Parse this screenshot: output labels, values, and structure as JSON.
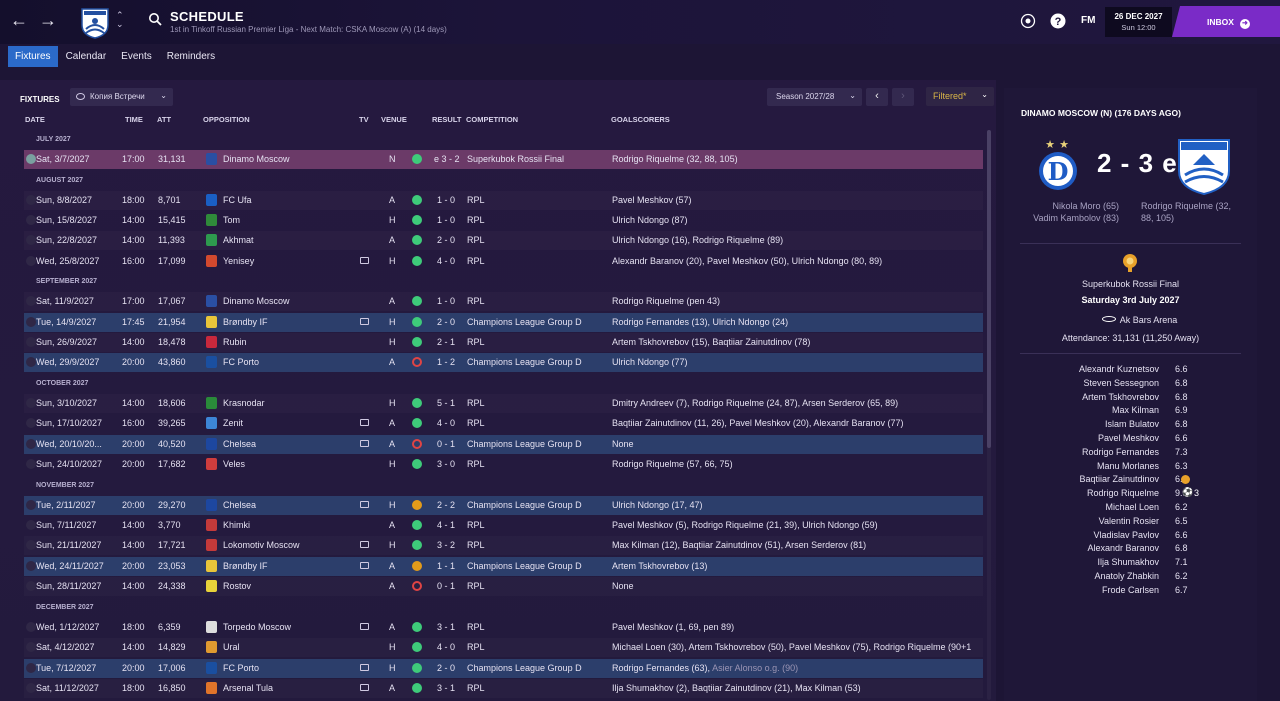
{
  "header": {
    "title": "SCHEDULE",
    "subtitle": "1st in Tinkoff Russian Premier Liga - Next Match: CSKA Moscow (A) (14 days)",
    "fm": "FM",
    "date": "26 DEC 2027",
    "time": "Sun 12:00",
    "inbox": "INBOX"
  },
  "tabs": [
    "Fixtures",
    "Calendar",
    "Events",
    "Reminders"
  ],
  "toolbar": {
    "fixtures_label": "FIXTURES",
    "view": "Копия Встречи",
    "season": "Season 2027/28",
    "filter": "Filtered*"
  },
  "columns": {
    "date": "DATE",
    "time": "TIME",
    "att": "ATT",
    "opposition": "OPPOSITION",
    "tv": "TV",
    "venue": "VENUE",
    "result": "RESULT",
    "competition": "COMPETITION",
    "goalscorers": "GOALSCORERS"
  },
  "months": [
    "JULY 2027",
    "AUGUST 2027",
    "SEPTEMBER 2027",
    "OCTOBER 2027",
    "NOVEMBER 2027",
    "DECEMBER 2027"
  ],
  "fixtures": [
    {
      "date": "Sat, 3/7/2027",
      "time": "17:00",
      "att": "31,131",
      "opp": "Dinamo Moscow",
      "venue": "N",
      "score": "e 3 - 2",
      "comp": "Superkubok Rossii Final",
      "scorers": "Rodrigo Riquelme (32, 88, 105)"
    },
    {
      "date": "Sun, 8/8/2027",
      "time": "18:00",
      "att": "8,701",
      "opp": "FC Ufa",
      "venue": "A",
      "score": "1 - 0",
      "comp": "RPL",
      "scorers": "Pavel Meshkov (57)"
    },
    {
      "date": "Sun, 15/8/2027",
      "time": "14:00",
      "att": "15,415",
      "opp": "Tom",
      "venue": "H",
      "score": "1 - 0",
      "comp": "RPL",
      "scorers": "Ulrich Ndongo (87)"
    },
    {
      "date": "Sun, 22/8/2027",
      "time": "14:00",
      "att": "11,393",
      "opp": "Akhmat",
      "venue": "A",
      "score": "2 - 0",
      "comp": "RPL",
      "scorers": "Ulrich Ndongo (16), Rodrigo Riquelme (89)"
    },
    {
      "date": "Wed, 25/8/2027",
      "time": "16:00",
      "att": "17,099",
      "opp": "Yenisey",
      "venue": "H",
      "score": "4 - 0",
      "comp": "RPL",
      "scorers": "Alexandr Baranov (20), Pavel Meshkov (50), Ulrich Ndongo (80, 89)"
    },
    {
      "date": "Sat, 11/9/2027",
      "time": "17:00",
      "att": "17,067",
      "opp": "Dinamo Moscow",
      "venue": "A",
      "score": "1 - 0",
      "comp": "RPL",
      "scorers": "Rodrigo Riquelme (pen 43)"
    },
    {
      "date": "Tue, 14/9/2027",
      "time": "17:45",
      "att": "21,954",
      "opp": "Brøndby IF",
      "venue": "H",
      "score": "2 - 0",
      "comp": "Champions League Group D",
      "scorers": "Rodrigo Fernandes (13), Ulrich Ndongo (24)"
    },
    {
      "date": "Sun, 26/9/2027",
      "time": "14:00",
      "att": "18,478",
      "opp": "Rubin",
      "venue": "H",
      "score": "2 - 1",
      "comp": "RPL",
      "scorers": "Artem Tskhovrebov (15), Baqtiiar Zainutdinov (78)"
    },
    {
      "date": "Wed, 29/9/2027",
      "time": "20:00",
      "att": "43,860",
      "opp": "FC Porto",
      "venue": "A",
      "score": "1 - 2",
      "comp": "Champions League Group D",
      "scorers": "Ulrich Ndongo (77)"
    },
    {
      "date": "Sun, 3/10/2027",
      "time": "14:00",
      "att": "18,606",
      "opp": "Krasnodar",
      "venue": "H",
      "score": "5 - 1",
      "comp": "RPL",
      "scorers": "Dmitry Andreev (7), Rodrigo Riquelme (24, 87), Arsen Serderov (65, 89)"
    },
    {
      "date": "Sun, 17/10/2027",
      "time": "16:00",
      "att": "39,265",
      "opp": "Zenit",
      "venue": "A",
      "score": "4 - 0",
      "comp": "RPL",
      "scorers": "Baqtiiar Zainutdinov (11, 26), Pavel Meshkov (20), Alexandr Baranov (77)"
    },
    {
      "date": "Wed, 20/10/20...",
      "time": "20:00",
      "att": "40,520",
      "opp": "Chelsea",
      "venue": "A",
      "score": "0 - 1",
      "comp": "Champions League Group D",
      "scorers": "None"
    },
    {
      "date": "Sun, 24/10/2027",
      "time": "20:00",
      "att": "17,682",
      "opp": "Veles",
      "venue": "H",
      "score": "3 - 0",
      "comp": "RPL",
      "scorers": "Rodrigo Riquelme (57, 66, 75)"
    },
    {
      "date": "Tue, 2/11/2027",
      "time": "20:00",
      "att": "29,270",
      "opp": "Chelsea",
      "venue": "H",
      "score": "2 - 2",
      "comp": "Champions League Group D",
      "scorers": "Ulrich Ndongo (17, 47)"
    },
    {
      "date": "Sun, 7/11/2027",
      "time": "14:00",
      "att": "3,770",
      "opp": "Khimki",
      "venue": "A",
      "score": "4 - 1",
      "comp": "RPL",
      "scorers": "Pavel Meshkov (5), Rodrigo Riquelme (21, 39), Ulrich Ndongo (59)"
    },
    {
      "date": "Sun, 21/11/2027",
      "time": "14:00",
      "att": "17,721",
      "opp": "Lokomotiv Moscow",
      "venue": "H",
      "score": "3 - 2",
      "comp": "RPL",
      "scorers": "Max Kilman (12), Baqtiiar Zainutdinov (51), Arsen Serderov (81)"
    },
    {
      "date": "Wed, 24/11/2027",
      "time": "20:00",
      "att": "23,053",
      "opp": "Brøndby IF",
      "venue": "A",
      "score": "1 - 1",
      "comp": "Champions League Group D",
      "scorers": "Artem Tskhovrebov (13)"
    },
    {
      "date": "Sun, 28/11/2027",
      "time": "14:00",
      "att": "24,338",
      "opp": "Rostov",
      "venue": "A",
      "score": "0 - 1",
      "comp": "RPL",
      "scorers": "None"
    },
    {
      "date": "Wed, 1/12/2027",
      "time": "18:00",
      "att": "6,359",
      "opp": "Torpedo Moscow",
      "venue": "A",
      "score": "3 - 1",
      "comp": "RPL",
      "scorers": "Pavel Meshkov (1, 69, pen 89)"
    },
    {
      "date": "Sat, 4/12/2027",
      "time": "14:00",
      "att": "14,829",
      "opp": "Ural",
      "venue": "H",
      "score": "4 - 0",
      "comp": "RPL",
      "scorers": "Michael Loen (30), Artem Tskhovrebov (50), Pavel Meshkov (75), Rodrigo Riquelme (90+1"
    },
    {
      "date": "Tue, 7/12/2027",
      "time": "20:00",
      "att": "17,006",
      "opp": "FC Porto",
      "venue": "H",
      "score": "2 - 0",
      "comp": "Champions League Group D",
      "scorers": "Rodrigo Fernandes (63),",
      "scorers2": "Asier Alonso o.g. (90)"
    },
    {
      "date": "Sat, 11/12/2027",
      "time": "18:00",
      "att": "16,850",
      "opp": "Arsenal Tula",
      "venue": "A",
      "score": "3 - 1",
      "comp": "RPL",
      "scorers": "Ilja Shumakhov (2), Baqtiiar Zainutdinov (21), Max Kilman (53)"
    }
  ],
  "summary": {
    "title": "DINAMO MOSCOW (N) (176 DAYS AGO)",
    "score": "2 - 3 e",
    "home_scorers": [
      "Nikola Moro (65)",
      "Vadim Kambolov (83)"
    ],
    "away_scorers": [
      "Rodrigo Riquelme (32,",
      "88, 105)"
    ],
    "competition": "Superkubok Rossii Final",
    "date": "Saturday 3rd July 2027",
    "stadium": "Ak Bars Arena",
    "attendance": "Attendance: 31,131 (11,250 Away)"
  },
  "ratings": [
    {
      "name": "Alexandr Kuznetsov",
      "rating": "6.6"
    },
    {
      "name": "Steven Sessegnon",
      "rating": "6.8"
    },
    {
      "name": "Artem Tskhovrebov",
      "rating": "6.8"
    },
    {
      "name": "Max Kilman",
      "rating": "6.9"
    },
    {
      "name": "Islam Bulatov",
      "rating": "6.8"
    },
    {
      "name": "Pavel Meshkov",
      "rating": "6.6"
    },
    {
      "name": "Rodrigo Fernandes",
      "rating": "7.3"
    },
    {
      "name": "Manu Morlanes",
      "rating": "6.3"
    },
    {
      "name": "Baqtiiar Zainutdinov",
      "rating": "6.6"
    },
    {
      "name": "Rodrigo Riquelme",
      "rating": "9.8",
      "goals": "3"
    },
    {
      "name": "Michael Loen",
      "rating": "6.2"
    },
    {
      "name": "Valentin Rosier",
      "rating": "6.5"
    },
    {
      "name": "Vladislav Pavlov",
      "rating": "6.6"
    },
    {
      "name": "Alexandr Baranov",
      "rating": "6.8"
    },
    {
      "name": "Ilja Shumakhov",
      "rating": "7.1"
    },
    {
      "name": "Anatoly Zhabkin",
      "rating": "6.2"
    },
    {
      "name": "Frode Carlsen",
      "rating": "6.7"
    }
  ],
  "colors": {
    "accent": "#2b6ac9",
    "inbox": "#7a2bc7",
    "win": "#3ecb7a",
    "loss": "#e04444",
    "draw": "#e39b1a",
    "selected": "#6b3a68",
    "cl_row": "#2c3e6b"
  }
}
